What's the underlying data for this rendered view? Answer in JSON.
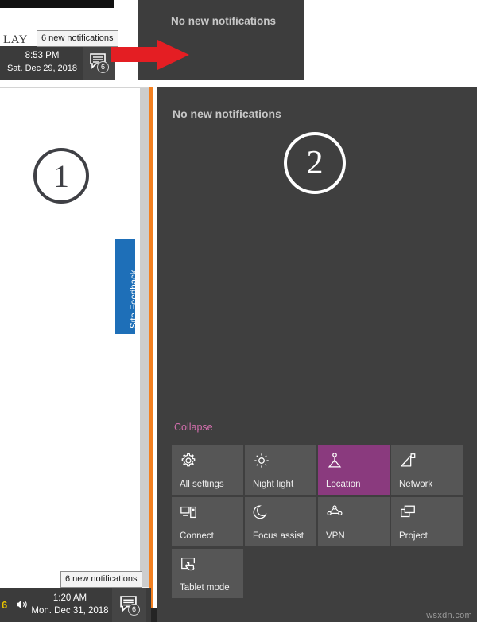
{
  "window": {
    "background_color": "#ffffff",
    "accent_orange": "#f38020"
  },
  "top_capture": {
    "page_text_fragment": "LAY",
    "tooltip": "6 new notifications",
    "taskbar": {
      "time": "8:53 PM",
      "date": "Sat. Dec 29, 2018",
      "notification_icon": "notification-chat-icon",
      "notification_count": "6"
    },
    "notification_panel": {
      "title": "No new notifications"
    },
    "arrow": {
      "icon": "right-arrow-icon",
      "color": "#e41e23"
    }
  },
  "annotations": {
    "step_one": "1",
    "step_two": "2"
  },
  "site_feedback": {
    "label": "Site Feedback",
    "color": "#1e6fb8"
  },
  "action_center": {
    "title": "No new notifications",
    "collapse_label": "Collapse",
    "collapse_color": "#d36fad",
    "tiles": [
      {
        "label": "All settings",
        "icon": "gear-icon",
        "active": false
      },
      {
        "label": "Night light",
        "icon": "brightness-icon",
        "active": false
      },
      {
        "label": "Location",
        "icon": "location-pin-icon",
        "active": true
      },
      {
        "label": "Network",
        "icon": "wifi-icon",
        "active": false
      },
      {
        "label": "Connect",
        "icon": "connect-icon",
        "active": false
      },
      {
        "label": "Focus assist",
        "icon": "moon-icon",
        "active": false
      },
      {
        "label": "VPN",
        "icon": "vpn-icon",
        "active": false
      },
      {
        "label": "Project",
        "icon": "project-icon",
        "active": false
      },
      {
        "label": "Tablet mode",
        "icon": "tablet-hand-icon",
        "active": false
      }
    ],
    "active_tile_color": "#8a3a7e"
  },
  "bottom_capture": {
    "tooltip": "6 new notifications",
    "taskbar": {
      "overflow_count": "6",
      "volume_icon": "speaker-icon",
      "time": "1:20 AM",
      "date": "Mon. Dec 31, 2018",
      "notification_icon": "notification-chat-icon",
      "notification_count": "6"
    }
  },
  "watermark": {
    "text": "wsxdn.com"
  }
}
